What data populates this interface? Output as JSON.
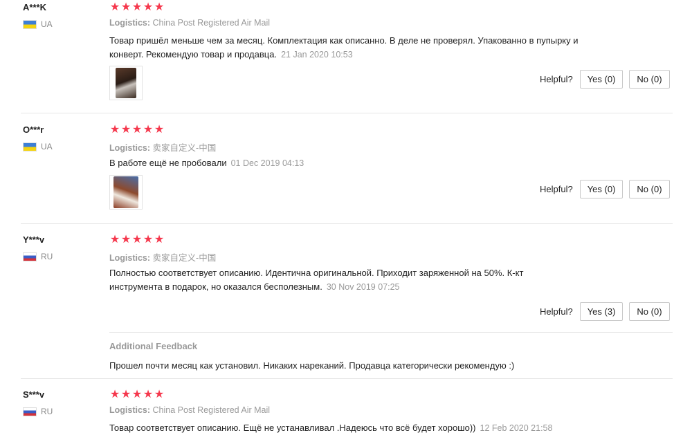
{
  "helpful_label": "Helpful?",
  "logistics_label": "Logistics:",
  "additional_feedback_label": "Additional Feedback",
  "colors": {
    "star": "#f5374c",
    "muted": "#999999",
    "border": "#e5e5e5"
  },
  "reviews": [
    {
      "user": "A***K",
      "country": "UA",
      "rating": 5,
      "logistics": "China Post Registered Air Mail",
      "text": "Товар пришёл меньше чем за месяц. Комплектация как описанно. В деле не проверял. Упакованно в пупырку и конверт. Рекомендую товар и продавца.",
      "date": "21 Jan 2020 10:53",
      "yes": "Yes (0)",
      "no": "No (0)"
    },
    {
      "user": "O***r",
      "country": "UA",
      "rating": 5,
      "logistics": "卖家自定义-中国",
      "text": "В работе ещё не пробовали",
      "date": "01 Dec 2019 04:13",
      "yes": "Yes (0)",
      "no": "No (0)"
    },
    {
      "user": "Y***v",
      "country": "RU",
      "rating": 5,
      "logistics": "卖家自定义-中国",
      "text": "Полностью соответствует описанию. Идентична оригинальной. Приходит заряженной на 50%. К-кт инструмента в подарок, но оказался бесполезным.",
      "date": "30 Nov 2019 07:25",
      "yes": "Yes (3)",
      "no": "No (0)",
      "additional_feedback": "Прошел почти месяц как установил. Никаких нареканий. Продавца категорически рекомендую :)"
    },
    {
      "user": "S***v",
      "country": "RU",
      "rating": 5,
      "logistics": "China Post Registered Air Mail",
      "text": "Товар соответствует описанию. Ещё не устанавливал .Надеюсь что всё будет хорошо))",
      "date": "12 Feb 2020 21:58"
    }
  ]
}
